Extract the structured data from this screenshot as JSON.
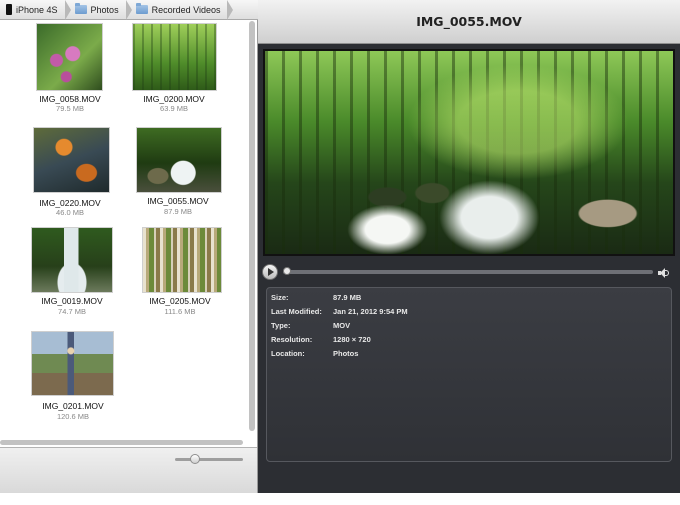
{
  "breadcrumb": [
    {
      "label": "iPhone 4S",
      "icon": "phone-icon"
    },
    {
      "label": "Photos",
      "icon": "folder-icon"
    },
    {
      "label": "Recorded Videos",
      "icon": "folder-icon"
    }
  ],
  "grid": {
    "items": [
      {
        "name": "IMG_0058.MOV",
        "size": "79.5 MB",
        "thumb": "orchid"
      },
      {
        "name": "IMG_0200.MOV",
        "size": "63.9 MB",
        "thumb": "forest"
      },
      {
        "name": "IMG_0220.MOV",
        "size": "46.0 MB",
        "thumb": "rocks"
      },
      {
        "name": "IMG_0055.MOV",
        "size": "87.9 MB",
        "thumb": "stream"
      },
      {
        "name": "IMG_0019.MOV",
        "size": "74.7 MB",
        "thumb": "falls"
      },
      {
        "name": "IMG_0205.MOV",
        "size": "111.6 MB",
        "thumb": "birch"
      },
      {
        "name": "IMG_0201.MOV",
        "size": "120.6 MB",
        "thumb": "boy"
      }
    ]
  },
  "zoom": {
    "value": 0.26
  },
  "viewer": {
    "title": "IMG_0055.MOV",
    "progress": 0.0
  },
  "info": {
    "size_label": "Size:",
    "size_value": "87.9 MB",
    "modified_label": "Last Modified:",
    "modified_value": "Jan 21, 2012 9:54 PM",
    "type_label": "Type:",
    "type_value": "MOV",
    "resolution_label": "Resolution:",
    "resolution_value": "1280 × 720",
    "location_label": "Location:",
    "location_value": "Photos"
  },
  "colors": {
    "panel_dark": "#2c2e33",
    "info_text": "#e8e8e8",
    "folder_blue": "#6d9ccf"
  }
}
